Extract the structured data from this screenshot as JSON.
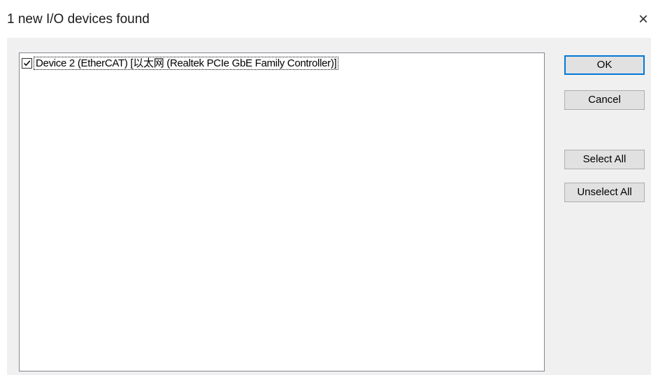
{
  "window": {
    "title": "1 new I/O devices found",
    "close_symbol": "×"
  },
  "device_list": {
    "items": [
      {
        "checked": true,
        "label": "Device 2 (EtherCAT)    [以太网 (Realtek PCIe GbE Family Controller)]"
      }
    ]
  },
  "buttons": {
    "ok": "OK",
    "cancel": "Cancel",
    "select_all": "Select All",
    "unselect_all": "Unselect All"
  },
  "icons": {
    "close": "close-icon",
    "check": "checkmark-icon"
  },
  "colors": {
    "focus_border": "#0078d7",
    "button_face": "#e1e1e1",
    "dialog_background": "#f0f0f0"
  }
}
